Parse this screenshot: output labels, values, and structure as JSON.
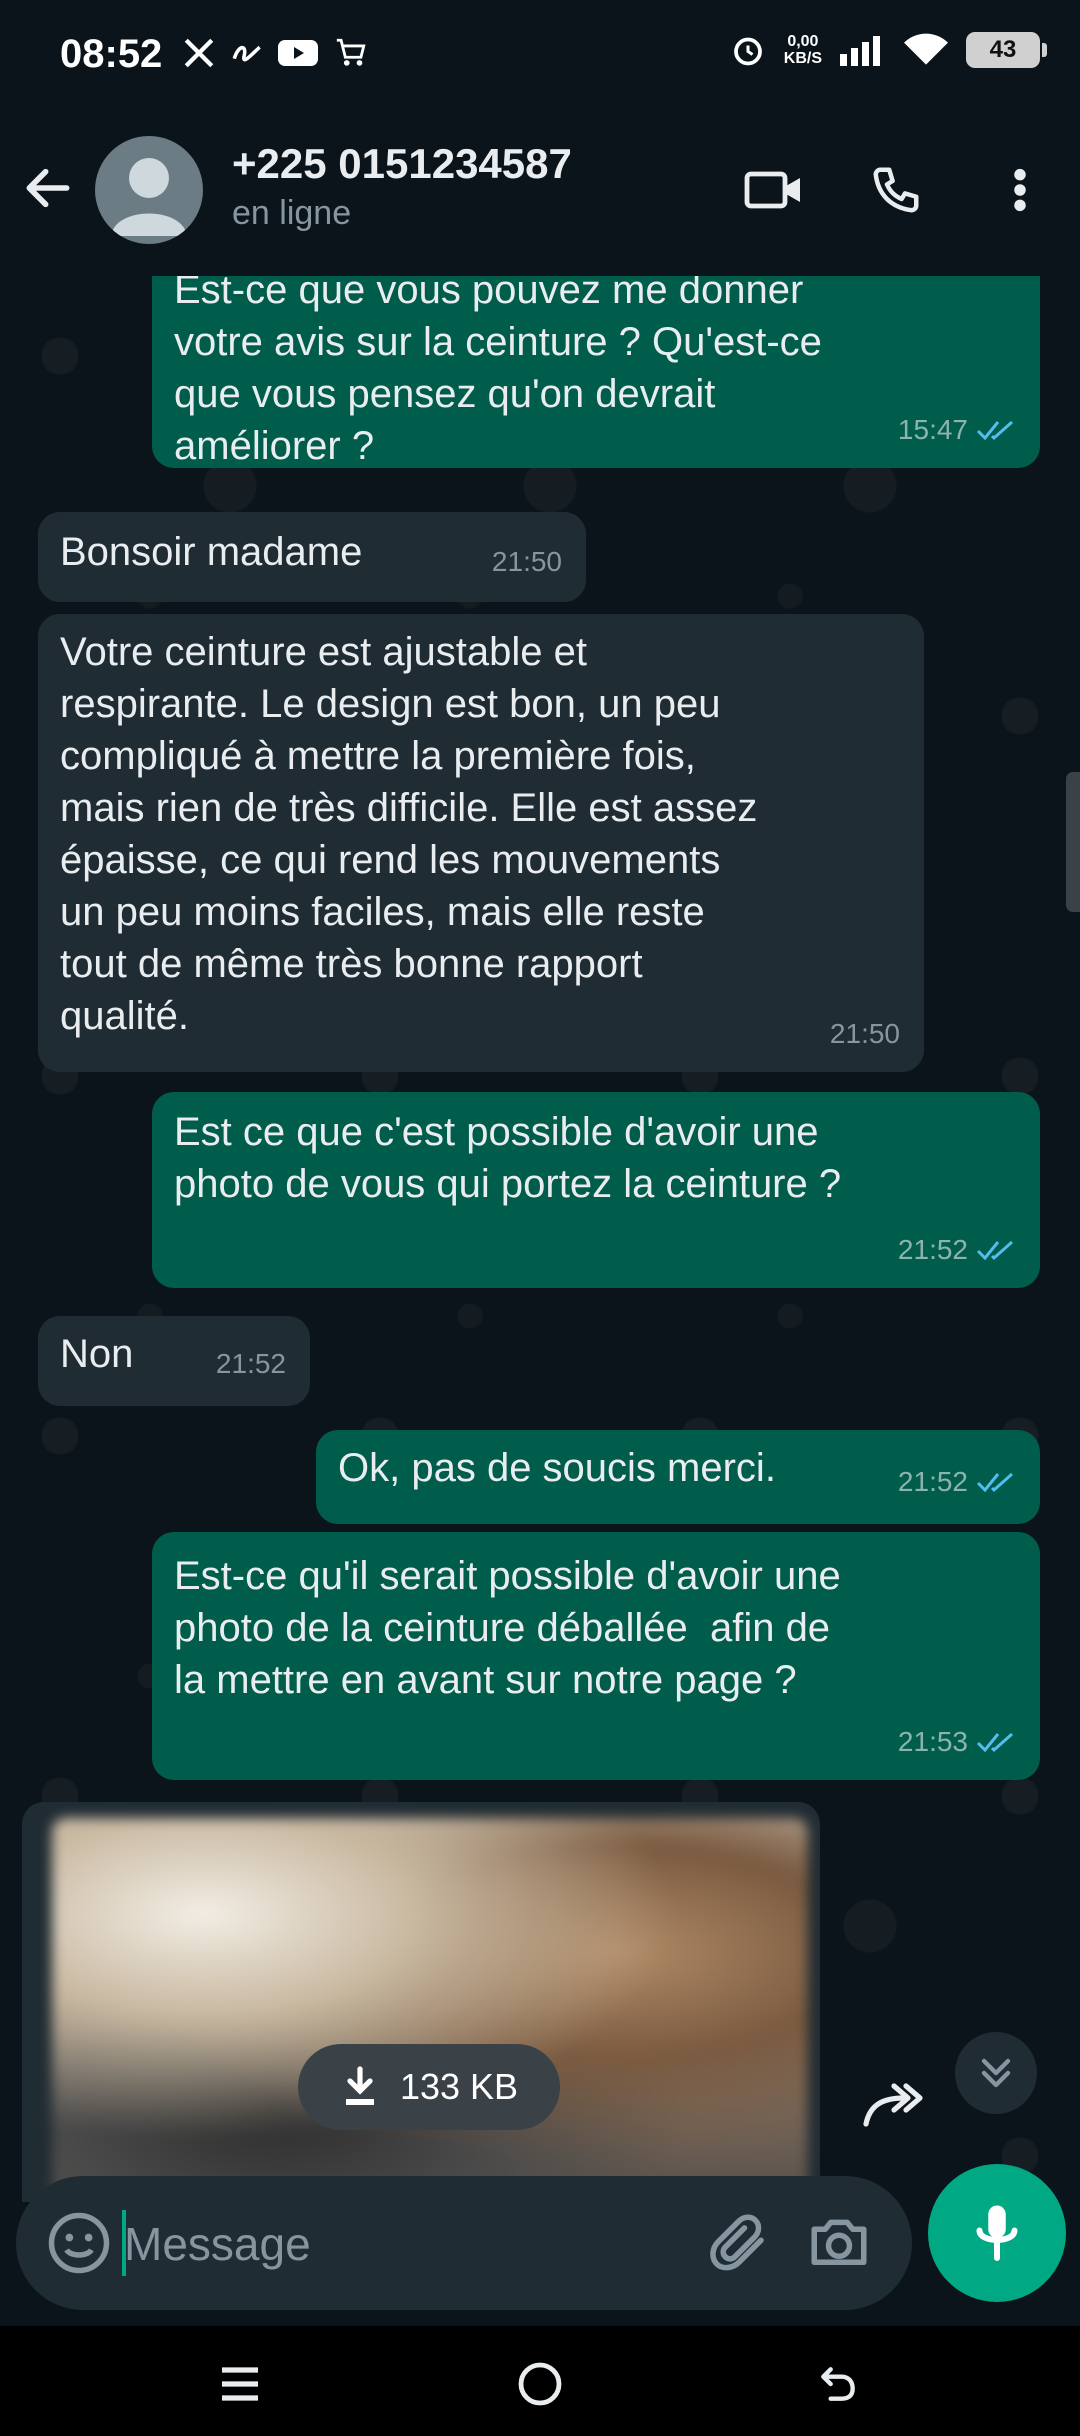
{
  "status_bar": {
    "time": "08:52",
    "netspeed_value": "0,00",
    "netspeed_unit": "KB/S",
    "battery": "43"
  },
  "header": {
    "contact_name": "+225 0151234587",
    "contact_status": "en ligne",
    "icons": [
      "back-arrow-icon",
      "video-call-icon",
      "voice-call-icon",
      "more-options-icon"
    ]
  },
  "messages": [
    {
      "direction": "out",
      "text": "Est-ce que vous pouvez me donner\nvotre avis sur la ceinture ? Qu'est-ce\nque vous pensez qu'on devrait\naméliorer ?",
      "time": "15:47",
      "read": true
    },
    {
      "direction": "in",
      "text": "Bonsoir madame",
      "time": "21:50"
    },
    {
      "direction": "in",
      "text": "Votre ceinture est ajustable et\nrespirante. Le design est bon, un peu\ncompliqué à mettre la première fois,\nmais rien de très difficile. Elle est assez\népaisse, ce qui rend les mouvements\nun peu moins faciles, mais elle reste\ntout de même très bonne rapport\nqualité.",
      "time": "21:50"
    },
    {
      "direction": "out",
      "text": "Est ce que c'est possible d'avoir une\nphoto de vous qui portez la ceinture ?",
      "time": "21:52",
      "read": true
    },
    {
      "direction": "in",
      "text": "Non",
      "time": "21:52"
    },
    {
      "direction": "out",
      "text": "Ok, pas de soucis merci.",
      "time": "21:52",
      "read": true
    },
    {
      "direction": "out",
      "text": "Est-ce qu'il serait possible d'avoir une\nphoto de la ceinture déballée  afin de\nla mettre en avant sur notre page ?",
      "time": "21:53",
      "read": true
    }
  ],
  "media": {
    "download_size": "133 KB"
  },
  "composer": {
    "placeholder": "Message"
  },
  "colors": {
    "background": "#0b141a",
    "outgoing_bubble": "#005c4b",
    "incoming_bubble": "#202c33",
    "accent": "#00a884",
    "read_ticks": "#53bdeb"
  }
}
